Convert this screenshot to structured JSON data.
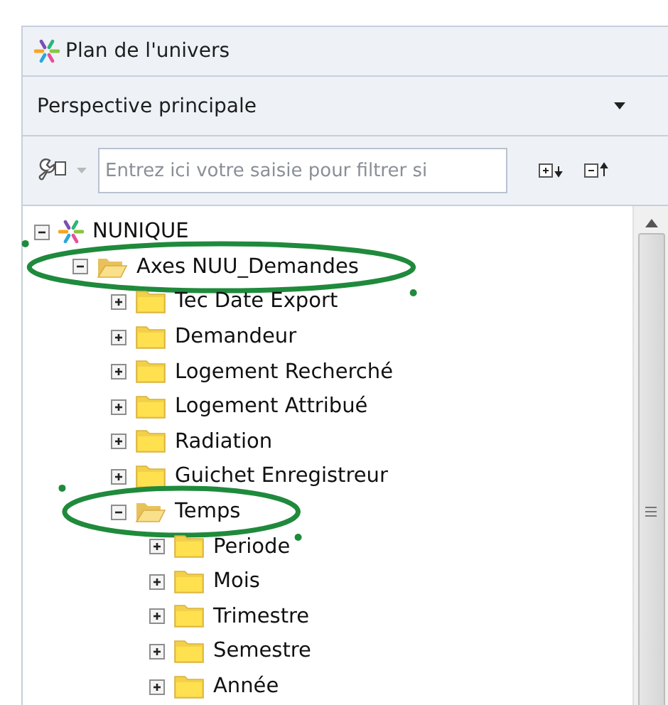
{
  "panel": {
    "title": "Plan de l'univers"
  },
  "perspective": {
    "value": "Perspective principale"
  },
  "filter": {
    "placeholder": "Entrez ici votre saisie pour filtrer si"
  },
  "tree": [
    {
      "label": "NUNIQUE",
      "kind": "universe",
      "expanded": true,
      "highlighted": false,
      "children": [
        {
          "label": "Axes NUU_Demandes",
          "kind": "folder",
          "expanded": true,
          "highlighted": true,
          "children": [
            {
              "label": "Tec Date Export",
              "kind": "folder",
              "expanded": false,
              "highlighted": false
            },
            {
              "label": "Demandeur",
              "kind": "folder",
              "expanded": false,
              "highlighted": false
            },
            {
              "label": "Logement Recherché",
              "kind": "folder",
              "expanded": false,
              "highlighted": false
            },
            {
              "label": "Logement Attribué",
              "kind": "folder",
              "expanded": false,
              "highlighted": false
            },
            {
              "label": "Radiation",
              "kind": "folder",
              "expanded": false,
              "highlighted": false
            },
            {
              "label": "Guichet Enregistreur",
              "kind": "folder",
              "expanded": false,
              "highlighted": false
            },
            {
              "label": "Temps",
              "kind": "folder",
              "expanded": true,
              "highlighted": true,
              "children": [
                {
                  "label": "Periode",
                  "kind": "folder",
                  "expanded": false,
                  "highlighted": false
                },
                {
                  "label": "Mois",
                  "kind": "folder",
                  "expanded": false,
                  "highlighted": false
                },
                {
                  "label": "Trimestre",
                  "kind": "folder",
                  "expanded": false,
                  "highlighted": false
                },
                {
                  "label": "Semestre",
                  "kind": "folder",
                  "expanded": false,
                  "highlighted": false
                },
                {
                  "label": "Année",
                  "kind": "folder",
                  "expanded": false,
                  "highlighted": false
                }
              ]
            }
          ]
        }
      ]
    }
  ]
}
